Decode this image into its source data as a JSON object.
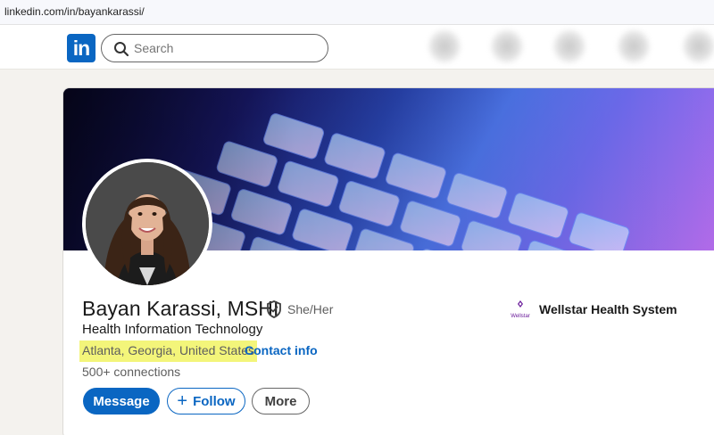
{
  "browser": {
    "url": "linkedin.com/in/bayankarassi/"
  },
  "nav": {
    "logo_text": "in",
    "search": {
      "placeholder": "Search",
      "icon": "search-icon"
    },
    "blurred_items": [
      "nav-home-icon",
      "nav-network-icon",
      "nav-jobs-icon",
      "nav-messaging-icon",
      "nav-notifications-icon"
    ]
  },
  "profile": {
    "name": "Bayan Karassi, MSHI",
    "verified_icon": "verified-shield-icon",
    "pronouns": "She/Her",
    "headline": "Health Information Technology",
    "location": "Atlanta, Georgia, United States",
    "separator": "·",
    "contact_info": "Contact info",
    "connections": "500+ connections",
    "buttons": {
      "message": "Message",
      "follow": "Follow",
      "follow_icon": "+",
      "more": "More"
    },
    "company": {
      "name": "Wellstar Health System",
      "logo_text": "Wellstar",
      "logo_color": "#6a1b9a"
    }
  },
  "colors": {
    "brand": "#0a66c2",
    "highlight": "#f3f57a",
    "page_bg": "#f4f2ee"
  }
}
